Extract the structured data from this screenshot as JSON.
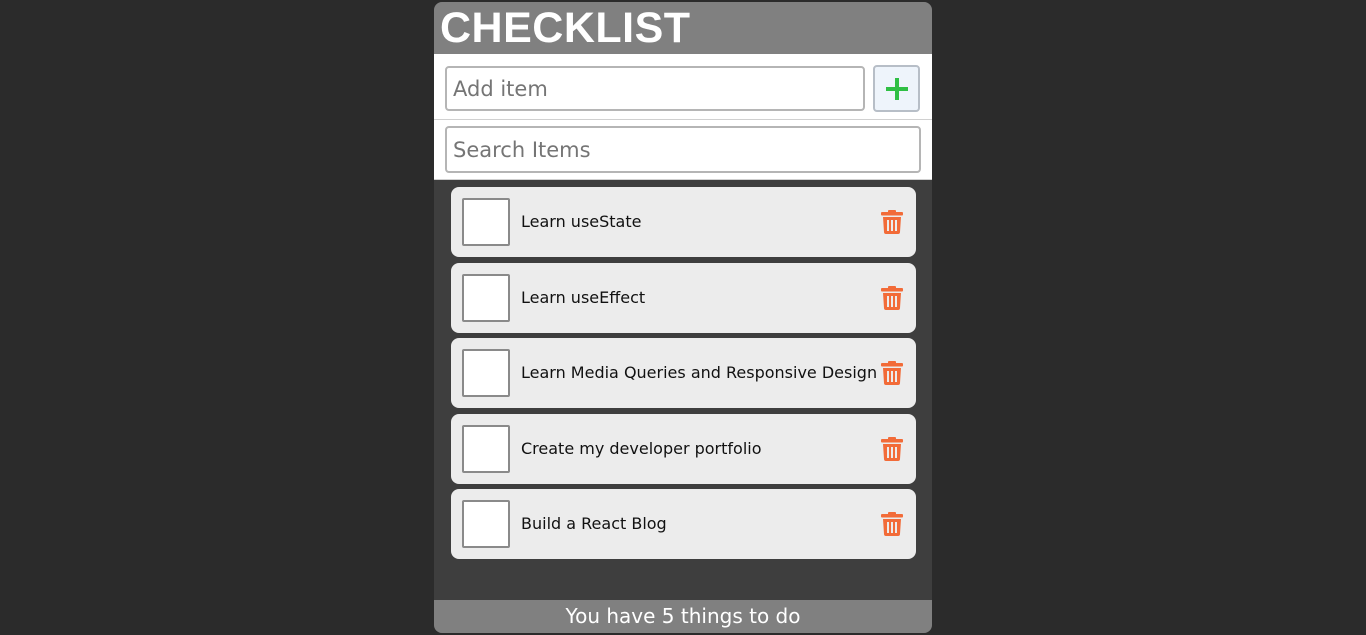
{
  "header": {
    "title": "CHECKLIST"
  },
  "add_item": {
    "placeholder": "Add item",
    "button_icon": "plus-icon"
  },
  "search": {
    "placeholder": "Search Items"
  },
  "items": [
    {
      "label": "Learn useState",
      "checked": false
    },
    {
      "label": "Learn useEffect",
      "checked": false
    },
    {
      "label": "Learn Media Queries and Responsive Design",
      "checked": false
    },
    {
      "label": "Create my developer portfolio",
      "checked": false
    },
    {
      "label": "Build a React Blog",
      "checked": false
    }
  ],
  "footer": {
    "text": "You have 5 things to do"
  },
  "colors": {
    "trash": "#f26b38",
    "add_icon": "#2fbf44",
    "header_bg": "#808080",
    "list_bg": "#3e3e3e"
  }
}
